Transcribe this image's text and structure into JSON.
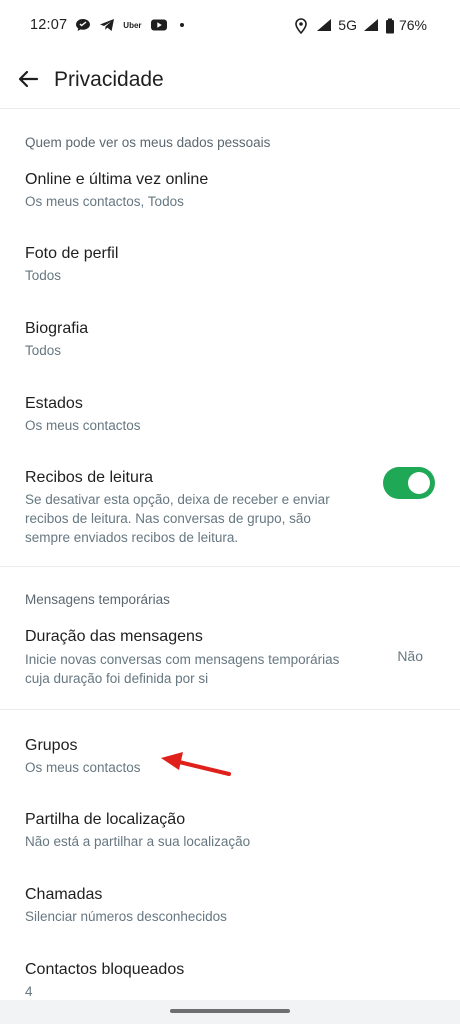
{
  "status_bar": {
    "time": "12:07",
    "uber_label": "Uber",
    "network": "5G",
    "battery": "76%",
    "icons": [
      "chat-icon",
      "telegram-icon",
      "uber-icon",
      "youtube-icon",
      "location-icon",
      "signal-icon",
      "battery-icon"
    ]
  },
  "app_bar": {
    "title": "Privacidade",
    "back_icon": "arrow-back-icon"
  },
  "sections": {
    "personal": {
      "header": "Quem pode ver os meus dados pessoais",
      "items": [
        {
          "title": "Online e última vez online",
          "subtitle": "Os meus contactos, Todos"
        },
        {
          "title": "Foto de perfil",
          "subtitle": "Todos"
        },
        {
          "title": "Biografia",
          "subtitle": "Todos"
        },
        {
          "title": "Estados",
          "subtitle": "Os meus contactos"
        }
      ],
      "read_receipts": {
        "title": "Recibos de leitura",
        "subtitle_lines": [
          "Se desativar esta opção, deixa de receber e enviar",
          "recibos de leitura. Nas conversas de grupo, são",
          "sempre enviados recibos de leitura."
        ],
        "enabled": true
      }
    },
    "temporary": {
      "header": "Mensagens temporárias",
      "item": {
        "title": "Duração das mensagens",
        "subtitle_lines": [
          "Inicie novas conversas com mensagens temporárias",
          "cuja duração foi definida por si"
        ],
        "value": "Não"
      }
    },
    "other": {
      "items": [
        {
          "title": "Grupos",
          "subtitle": "Os meus contactos"
        },
        {
          "title": "Partilha de localização",
          "subtitle": "Não está a partilhar a sua localização"
        },
        {
          "title": "Chamadas",
          "subtitle": "Silenciar números desconhecidos"
        },
        {
          "title": "Contactos bloqueados",
          "subtitle": "4"
        }
      ]
    }
  },
  "colors": {
    "accent": "#1fa855",
    "annotation": "#e0201b",
    "secondary_text": "#667781"
  }
}
